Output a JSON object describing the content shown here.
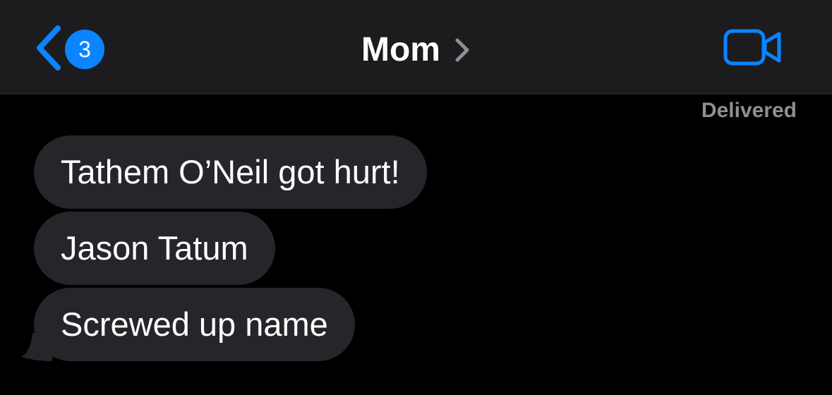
{
  "nav": {
    "back_badge_count": "3",
    "title": "Mom"
  },
  "status": {
    "delivered_label": "Delivered"
  },
  "messages": [
    {
      "text": "Tathem O’Neil got hurt!"
    },
    {
      "text": "Jason Tatum"
    },
    {
      "text": "Screwed up name"
    }
  ],
  "icons": {
    "back": "chevron-left-icon",
    "title_disclosure": "chevron-right-icon",
    "video": "video-camera-icon"
  },
  "colors": {
    "accent": "#0a84ff",
    "nav_background": "#1c1c1e",
    "page_background": "#000000",
    "incoming_bubble": "#26252a",
    "secondary_text": "#8e8e93"
  }
}
